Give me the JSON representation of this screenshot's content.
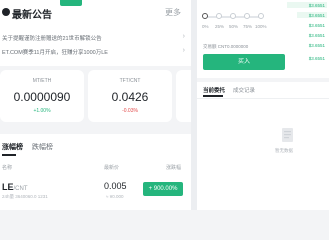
{
  "header": {
    "title": "最新公告",
    "more": "更多"
  },
  "news": [
    "关于提醒谨防注册赠送的21世币解锁公告",
    "ET.COM赛季11月开启，狂赚分享1000万LE"
  ],
  "cards": [
    {
      "pair": "MT/ETH",
      "price": "0.0000090",
      "change": "+1.00%",
      "change_color": "#25b57d"
    },
    {
      "pair": "TFT/CNT",
      "price": "0.0426",
      "change": "-0.03%",
      "change_color": "#e24a4a"
    }
  ],
  "ranking": {
    "tab_active": "涨幅榜",
    "tab_other": "跌幅榜",
    "col_name": "名称",
    "col_price": "最新价",
    "col_change": "涨跌幅",
    "row": {
      "coin": "LE",
      "quote": "/CNT",
      "sub": "24h量 3640060.0 1231",
      "price": "0.005",
      "price_sub": "≈ ¥0.000",
      "change": "+ 900.00%"
    }
  },
  "trade": {
    "percentages": [
      "0%",
      "25%",
      "50%",
      "75%",
      "100%"
    ],
    "orderbook_green": [
      "$3.6551",
      "$3.6551",
      "$3.6551",
      "$3.6551",
      "$3.6551",
      "$3.6551"
    ],
    "fee_text": "交易额 CNT0.0000000",
    "buy_label": "买入",
    "order_tab_active": "当前委托",
    "order_tab_other": "成交记录",
    "empty_text": "暂无数据"
  },
  "colors": {
    "accent": "#25b57d",
    "down": "#e24a4a"
  }
}
